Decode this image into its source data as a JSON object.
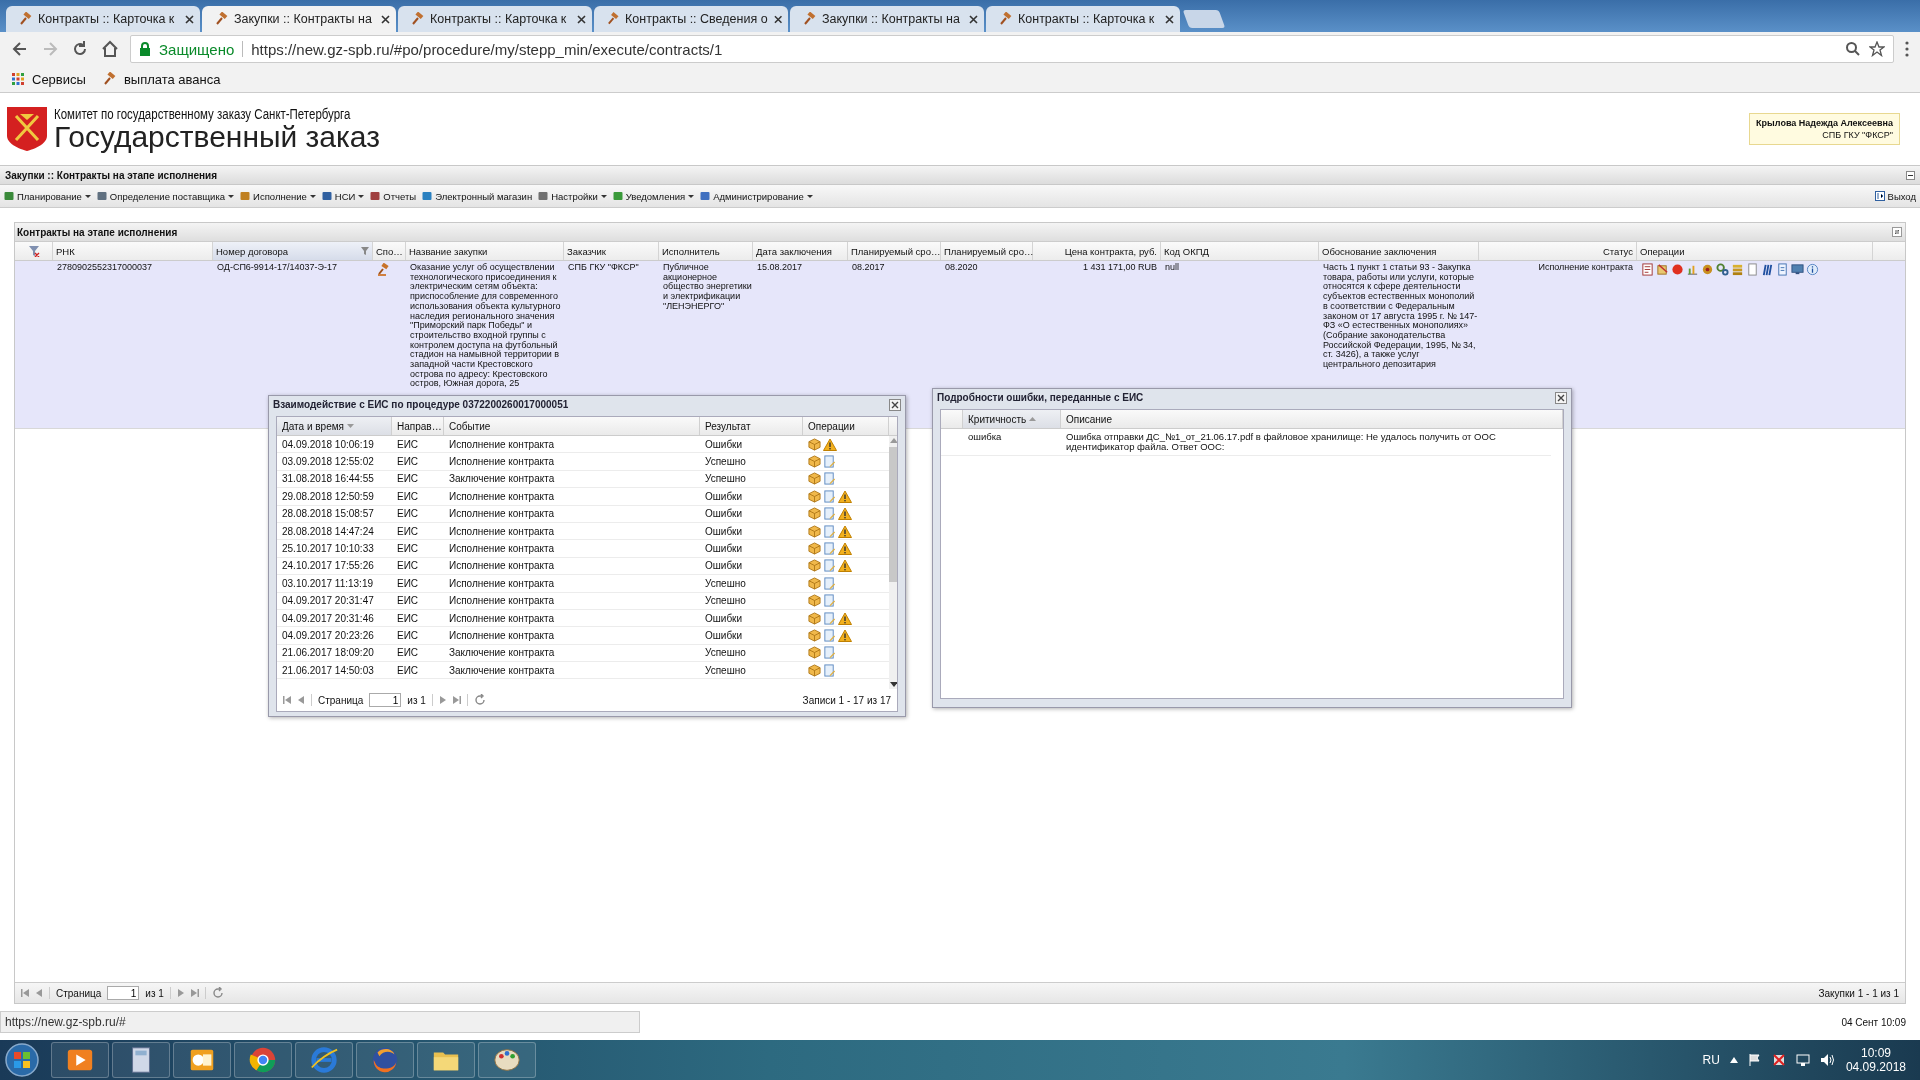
{
  "browser": {
    "tabs": [
      {
        "label": "Контракты :: Карточка к",
        "selected": false
      },
      {
        "label": "Закупки :: Контракты на",
        "selected": true
      },
      {
        "label": "Контракты :: Карточка к",
        "selected": false
      },
      {
        "label": "Контракты :: Сведения о",
        "selected": false
      },
      {
        "label": "Закупки :: Контракты на",
        "selected": false
      },
      {
        "label": "Контракты :: Карточка к",
        "selected": false
      }
    ],
    "secure_label": "Защищено",
    "url": "https://new.gz-spb.ru/#po/procedure/my/stepp_min/execute/contracts/1",
    "bookmarks": [
      {
        "label": "Сервисы",
        "kind": "apps"
      },
      {
        "label": "выплата аванса",
        "kind": "site"
      }
    ]
  },
  "header": {
    "org": "Комитет по государственному заказу Санкт-Петербурга",
    "title": "Государственный заказ",
    "user_name": "Крылова Надежда Алексеевна",
    "user_org": "СПБ ГКУ \"ФКСР\""
  },
  "app_title": "Закупки :: Контракты на этапе исполнения",
  "menu": [
    {
      "label": "Планирование",
      "dropdown": true
    },
    {
      "label": "Определение поставщика",
      "dropdown": true
    },
    {
      "label": "Исполнение",
      "dropdown": true
    },
    {
      "label": "НСИ",
      "dropdown": true
    },
    {
      "label": "Отчеты",
      "dropdown": false
    },
    {
      "label": "Электронный магазин",
      "dropdown": false
    },
    {
      "label": "Настройки",
      "dropdown": true
    },
    {
      "label": "Уведомления",
      "dropdown": true
    },
    {
      "label": "Администрирование",
      "dropdown": true
    }
  ],
  "logout": "Выход",
  "grid": {
    "title": "Контракты на этапе исполнения",
    "columns": [
      {
        "label": "РНК",
        "filter": false
      },
      {
        "label": "Номер договора",
        "filter": true
      },
      {
        "label": "Спо…",
        "filter": false
      },
      {
        "label": "Название закупки",
        "filter": false
      },
      {
        "label": "Заказчик",
        "filter": false
      },
      {
        "label": "Исполнитель",
        "filter": false
      },
      {
        "label": "Дата заключения",
        "filter": false
      },
      {
        "label": "Планируемый сро…",
        "filter": false
      },
      {
        "label": "Планируемый сро…",
        "filter": false
      },
      {
        "label": "Цена контракта, руб.",
        "filter": false
      },
      {
        "label": "Код ОКПД",
        "filter": false
      },
      {
        "label": "Обоснование заключения",
        "filter": false
      },
      {
        "label": "Статус",
        "filter": false
      },
      {
        "label": "Операции",
        "filter": false
      }
    ],
    "rows": [
      {
        "selected": true,
        "rnk": "2780902552317000037",
        "number": "ОД-СП6-9914-17/14037-Э-17",
        "name": "Оказание услуг об осуществлении технологического присоединения к электрическим сетям объекта: приспособление для современного использования объекта культурного наследия регионального значения \"Приморский парк Победы\" и строительство входной группы с контролем доступа на футбольный стадион на намывной территории в западной части Крестовского острова по адресу: Крестовского остров, Южная дорога, 25",
        "customer": "СПБ ГКУ \"ФКСР\"",
        "executor": "Публичное акционерное общество энергетики и электрификации \"ЛЕНЭНЕРГО\"",
        "date": "15.08.2017",
        "plan_1": "08.2017",
        "plan_2": "08.2020",
        "price": "1 431 171,00 RUB",
        "okpd": "null",
        "basis": "Часть 1 пункт 1 статьи 93 - Закупка товара, работы или услуги, которые относятся к сфере деятельности субъектов естественных монополий в соответствии с Федеральным законом от 17 августа 1995 г. № 147-ФЗ «О естественных монополиях» (Собрание законодательства Российской Федерации, 1995, № 34, ст. 3426), а также услуг центрального депозитария",
        "status": "Исполнение контракта"
      }
    ],
    "pager": {
      "page_label": "Страница",
      "page": "1",
      "of": "из 1",
      "records": "Закупки 1 - 1 из 1"
    }
  },
  "dialogs": [
    {
      "kind": "log",
      "title": "Взаимодействие с ЕИС по процедуре 0372200260017000051",
      "columns": [
        "Дата и время",
        "Направ…",
        "Событие",
        "Результат",
        "Операции"
      ],
      "rows": [
        {
          "datetime": "04.09.2018 10:06:19",
          "direction": "ЕИС",
          "event": "Исполнение контракта",
          "result": "Ошибки",
          "document": false,
          "warning": true
        },
        {
          "datetime": "03.09.2018 12:55:02",
          "direction": "ЕИС",
          "event": "Исполнение контракта",
          "result": "Успешно",
          "document": true,
          "warning": false
        },
        {
          "datetime": "31.08.2018 16:44:55",
          "direction": "ЕИС",
          "event": "Заключение контракта",
          "result": "Успешно",
          "document": true,
          "warning": false
        },
        {
          "datetime": "29.08.2018 12:50:59",
          "direction": "ЕИС",
          "event": "Исполнение контракта",
          "result": "Ошибки",
          "document": true,
          "warning": true
        },
        {
          "datetime": "28.08.2018 15:08:57",
          "direction": "ЕИС",
          "event": "Исполнение контракта",
          "result": "Ошибки",
          "document": true,
          "warning": true
        },
        {
          "datetime": "28.08.2018 14:47:24",
          "direction": "ЕИС",
          "event": "Исполнение контракта",
          "result": "Ошибки",
          "document": true,
          "warning": true
        },
        {
          "datetime": "25.10.2017 10:10:33",
          "direction": "ЕИС",
          "event": "Исполнение контракта",
          "result": "Ошибки",
          "document": true,
          "warning": true
        },
        {
          "datetime": "24.10.2017 17:55:26",
          "direction": "ЕИС",
          "event": "Исполнение контракта",
          "result": "Ошибки",
          "document": true,
          "warning": true
        },
        {
          "datetime": "03.10.2017 11:13:19",
          "direction": "ЕИС",
          "event": "Исполнение контракта",
          "result": "Успешно",
          "document": true,
          "warning": false
        },
        {
          "datetime": "04.09.2017 20:31:47",
          "direction": "ЕИС",
          "event": "Исполнение контракта",
          "result": "Успешно",
          "document": true,
          "warning": false
        },
        {
          "datetime": "04.09.2017 20:31:46",
          "direction": "ЕИС",
          "event": "Исполнение контракта",
          "result": "Ошибки",
          "document": true,
          "warning": true
        },
        {
          "datetime": "04.09.2017 20:23:26",
          "direction": "ЕИС",
          "event": "Исполнение контракта",
          "result": "Ошибки",
          "document": true,
          "warning": true
        },
        {
          "datetime": "21.06.2017 18:09:20",
          "direction": "ЕИС",
          "event": "Заключение контракта",
          "result": "Успешно",
          "document": true,
          "warning": false
        },
        {
          "datetime": "21.06.2017 14:50:03",
          "direction": "ЕИС",
          "event": "Заключение контракта",
          "result": "Успешно",
          "document": true,
          "warning": false
        }
      ],
      "pager": {
        "page_label": "Страница",
        "page": "1",
        "of": "из 1",
        "records": "Записи 1 - 17 из 17"
      }
    },
    {
      "kind": "details",
      "title": "Подробности ошибки, переданные с ЕИС",
      "columns": [
        "Критичность",
        "Описание"
      ],
      "rows": [
        {
          "severity": "ошибка",
          "description": "Ошибка отправки ДС_№1_от_21.06.17.pdf в файловое хранилище: Не удалось получить от ООС идентификатор файла. Ответ ООС:"
        }
      ]
    }
  ],
  "status": {
    "link_url": "https://new.gz-spb.ru/#",
    "datetime": "04 Сент 10:09"
  },
  "taskbar": {
    "language": "RU",
    "time": "10:09",
    "date": "04.09.2018"
  }
}
